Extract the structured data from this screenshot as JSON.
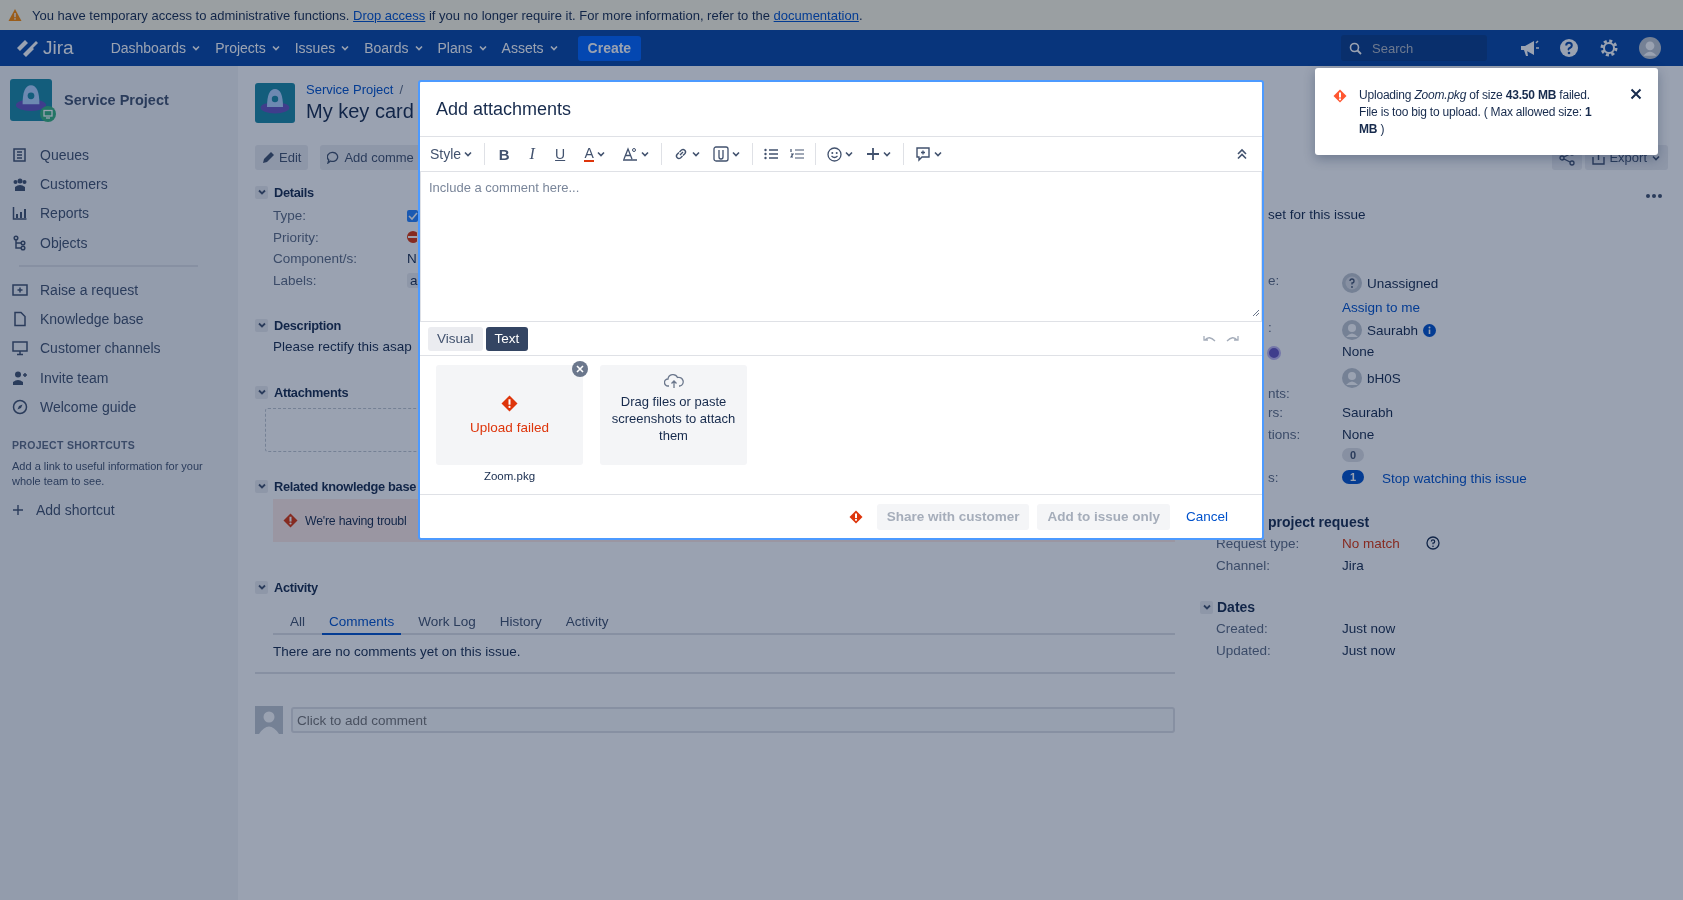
{
  "banner": {
    "segments": [
      {
        "kind": "text",
        "text": "You have temporary access to administrative functions. "
      },
      {
        "kind": "link",
        "text": "Drop access"
      },
      {
        "kind": "text",
        "text": " if you no longer require it. For more information, refer to the "
      },
      {
        "kind": "link",
        "text": "documentation"
      },
      {
        "kind": "text",
        "text": "."
      }
    ]
  },
  "nav": {
    "product": "Jira",
    "menus": [
      "Dashboards",
      "Projects",
      "Issues",
      "Boards",
      "Plans",
      "Assets"
    ],
    "create": "Create",
    "search": {
      "placeholder": "Search"
    }
  },
  "sidebar": {
    "project": "Service Project",
    "groups": [
      {
        "items": [
          "Queues",
          "Customers",
          "Reports",
          "Objects"
        ]
      },
      {
        "items": [
          "Raise a request",
          "Knowledge base",
          "Customer channels",
          "Invite team",
          "Welcome guide"
        ]
      }
    ],
    "shortcuts": {
      "heading": "PROJECT SHORTCUTS",
      "text": "Add a link to useful information for your whole team to see.",
      "add": "Add shortcut"
    }
  },
  "issue": {
    "breadcrumb": "Service Project",
    "separator": "/",
    "title": "My key card",
    "actions": [
      "Edit",
      "Add comme"
    ],
    "details": {
      "heading": "Details",
      "fields": [
        {
          "label": "Type:",
          "kind": "issue-type"
        },
        {
          "label": "Priority:",
          "kind": "priority"
        },
        {
          "label": "Component/s:",
          "kind": "text",
          "value": "N"
        },
        {
          "label": "Labels:",
          "kind": "lozenge",
          "value": "a"
        }
      ]
    },
    "description": {
      "heading": "Description",
      "text": "Please rectify this asap"
    },
    "attachments": {
      "heading": "Attachments"
    },
    "knowledge": {
      "heading": "Related knowledge base",
      "error": "We're having troubl"
    },
    "activity": {
      "heading": "Activity",
      "tabs": [
        {
          "label": "All",
          "selected": false
        },
        {
          "label": "Comments",
          "selected": true
        },
        {
          "label": "Work Log",
          "selected": false
        },
        {
          "label": "History",
          "selected": false
        },
        {
          "label": "Activity",
          "selected": false
        }
      ],
      "empty": "There are no comments yet on this issue.",
      "comment": {
        "placeholder": "Click to add comment"
      }
    }
  },
  "side": {
    "export": "Export",
    "sla_text": "set for this issue",
    "people": [
      {
        "label": "e:",
        "kind": "unassigned",
        "value": "Unassigned",
        "link": "Assign to me"
      },
      {
        "label": ":",
        "kind": "user",
        "value": "Saurabh",
        "info": true
      },
      {
        "kind": "text",
        "value": "None",
        "dot": true
      },
      {
        "label": "nts:",
        "kind": "user",
        "value": "bH0S"
      },
      {
        "label": "rs:",
        "kind": "text",
        "value": "Saurabh"
      },
      {
        "label": "tions:",
        "kind": "text",
        "value": "None"
      },
      {
        "kind": "count",
        "value": "0",
        "active": false
      },
      {
        "label": "s:",
        "kind": "count",
        "value": "1",
        "active": true,
        "link": "Stop watching this issue"
      }
    ],
    "request": {
      "heading": "project request",
      "fields": [
        {
          "label": "Request type:",
          "kind": "error",
          "value": "No match",
          "help": true
        },
        {
          "label": "Channel:",
          "kind": "text",
          "value": "Jira"
        }
      ]
    },
    "dates": {
      "heading": "Dates",
      "fields": [
        {
          "label": "Created:",
          "kind": "text",
          "value": "Just now"
        },
        {
          "label": "Updated:",
          "kind": "text",
          "value": "Just now"
        }
      ]
    }
  },
  "dialog": {
    "title": "Add attachments",
    "toolbar": {
      "style": "Style",
      "format": [
        "B",
        "I",
        "U",
        "A"
      ]
    },
    "editor": {
      "placeholder": "Include a comment here..."
    },
    "modes": [
      {
        "label": "Visual",
        "selected": false
      },
      {
        "label": "Text",
        "selected": true
      }
    ],
    "attachments": [
      {
        "kind": "failed",
        "status": "Upload failed",
        "filename": "Zoom.pkg"
      },
      {
        "kind": "dropzone",
        "text": "Drag files or paste screenshots to attach them"
      }
    ],
    "error": true,
    "buttons": [
      {
        "kind": "button",
        "label": "Share with customer",
        "disabled": true
      },
      {
        "kind": "button",
        "label": "Add to issue only",
        "disabled": true
      },
      {
        "kind": "link",
        "label": "Cancel",
        "disabled": false
      }
    ]
  },
  "toast": {
    "message": "Uploading *Zoom.pkg* of size **43.50 MB** failed. File is too big to upload. ( Max allowed size: **1 MB** )"
  }
}
